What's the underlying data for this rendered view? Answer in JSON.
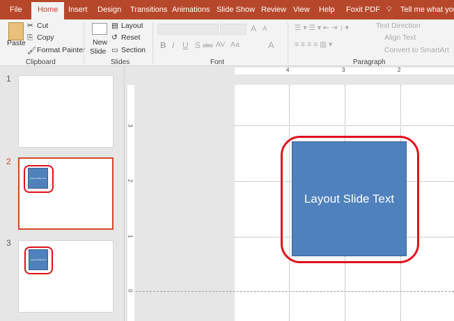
{
  "tabs": [
    "File",
    "Home",
    "Insert",
    "Design",
    "Transitions",
    "Animations",
    "Slide Show",
    "Review",
    "View",
    "Help",
    "Foxit PDF"
  ],
  "tell_me": "Tell me what you wa",
  "clipboard": {
    "paste": "Paste",
    "cut": "Cut",
    "copy": "Copy",
    "format_painter": "Format Painter",
    "label": "Clipboard"
  },
  "slides_group": {
    "new_slide_1": "New",
    "new_slide_2": "Slide",
    "layout": "Layout",
    "reset": "Reset",
    "section": "Section",
    "label": "Slides"
  },
  "font": {
    "label": "Font",
    "bold": "B",
    "italic": "I",
    "underline": "U",
    "shadow": "S",
    "strike": "abc",
    "spacing": "AV",
    "case": "Aa",
    "grow": "A",
    "shrink": "A",
    "color": "A"
  },
  "paragraph": {
    "label": "Paragraph",
    "text_direction": "Text Direction",
    "align_text": "Align Text",
    "smartart": "Convert to SmartArt"
  },
  "ruler": {
    "h": [
      "4",
      "3",
      "2"
    ],
    "v": [
      "3",
      "2",
      "1",
      "0"
    ]
  },
  "thumbnails": [
    {
      "num": "1",
      "text": ""
    },
    {
      "num": "2",
      "text": "Layout Slide Text"
    },
    {
      "num": "3",
      "text": "Layout Slide Text"
    }
  ],
  "selected_slide": 2,
  "slide": {
    "shape_text": "Layout Slide Text"
  },
  "colors": {
    "accent": "#b7472a",
    "shape": "#4f81bd",
    "highlight": "#e0101b"
  }
}
